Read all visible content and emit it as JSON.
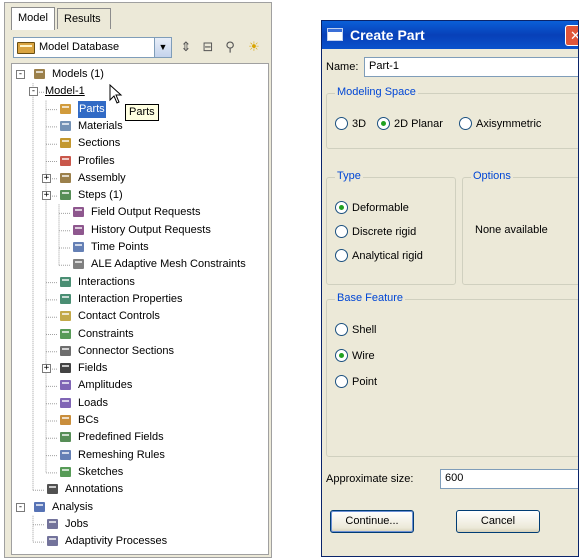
{
  "model_tree": {
    "tabs": [
      {
        "label": "Model",
        "active": true
      },
      {
        "label": "Results",
        "active": false
      }
    ],
    "database_selector": {
      "value": "Model Database"
    },
    "tooltip": "Parts",
    "nodes": [
      {
        "label": "Models (1)",
        "icon": "models-icon",
        "expander": "−"
      },
      {
        "label": "Model-1",
        "icon": "",
        "expander": "−"
      },
      {
        "label": "Parts",
        "icon": "parts-icon",
        "expander": ""
      },
      {
        "label": "Materials",
        "icon": "materials-icon",
        "expander": ""
      },
      {
        "label": "Sections",
        "icon": "sections-icon",
        "expander": ""
      },
      {
        "label": "Profiles",
        "icon": "profiles-icon",
        "expander": ""
      },
      {
        "label": "Assembly",
        "icon": "assembly-icon",
        "expander": "+"
      },
      {
        "label": "Steps (1)",
        "icon": "steps-icon",
        "expander": "+"
      },
      {
        "label": "Field Output Requests",
        "icon": "field-output-icon",
        "expander": ""
      },
      {
        "label": "History Output Requests",
        "icon": "history-output-icon",
        "expander": ""
      },
      {
        "label": "Time Points",
        "icon": "time-points-icon",
        "expander": ""
      },
      {
        "label": "ALE Adaptive Mesh Constraints",
        "icon": "ale-mesh-icon",
        "expander": ""
      },
      {
        "label": "Interactions",
        "icon": "interactions-icon",
        "expander": ""
      },
      {
        "label": "Interaction Properties",
        "icon": "interaction-properties-icon",
        "expander": ""
      },
      {
        "label": "Contact Controls",
        "icon": "contact-controls-icon",
        "expander": ""
      },
      {
        "label": "Constraints",
        "icon": "constraints-icon",
        "expander": ""
      },
      {
        "label": "Connector Sections",
        "icon": "connector-sections-icon",
        "expander": ""
      },
      {
        "label": "Fields",
        "icon": "fields-icon",
        "expander": "+"
      },
      {
        "label": "Amplitudes",
        "icon": "amplitudes-icon",
        "expander": ""
      },
      {
        "label": "Loads",
        "icon": "loads-icon",
        "expander": ""
      },
      {
        "label": "BCs",
        "icon": "bcs-icon",
        "expander": ""
      },
      {
        "label": "Predefined Fields",
        "icon": "predefined-fields-icon",
        "expander": ""
      },
      {
        "label": "Remeshing Rules",
        "icon": "remeshing-rules-icon",
        "expander": ""
      },
      {
        "label": "Sketches",
        "icon": "sketches-icon",
        "expander": ""
      },
      {
        "label": "Annotations",
        "icon": "annotations-icon",
        "expander": ""
      },
      {
        "label": "Analysis",
        "icon": "analysis-icon",
        "expander": "−"
      },
      {
        "label": "Jobs",
        "icon": "jobs-icon",
        "expander": ""
      },
      {
        "label": "Adaptivity Processes",
        "icon": "adaptivity-processes-icon",
        "expander": ""
      }
    ]
  },
  "dialog": {
    "title": "Create Part",
    "name_label": "Name:",
    "name_value": "Part-1",
    "modeling_space": {
      "title": "Modeling Space",
      "options": [
        {
          "label": "3D",
          "selected": false
        },
        {
          "label": "2D Planar",
          "selected": true
        },
        {
          "label": "Axisymmetric",
          "selected": false
        }
      ]
    },
    "type": {
      "title": "Type",
      "options": [
        {
          "label": "Deformable",
          "selected": true
        },
        {
          "label": "Discrete rigid",
          "selected": false
        },
        {
          "label": "Analytical rigid",
          "selected": false
        }
      ]
    },
    "options_group": {
      "title": "Options",
      "text": "None available"
    },
    "base_feature": {
      "title": "Base Feature",
      "options": [
        {
          "label": "Shell",
          "selected": false
        },
        {
          "label": "Wire",
          "selected": true
        },
        {
          "label": "Point",
          "selected": false
        }
      ]
    },
    "approx_size_label": "Approximate size:",
    "approx_size_value": "600",
    "continue_label": "Continue...",
    "cancel_label": "Cancel"
  },
  "colors": {
    "selection": "#316ac5",
    "titlebar": "#0a5fd8",
    "group_title": "#0046d5",
    "radio_check": "#21a121"
  }
}
